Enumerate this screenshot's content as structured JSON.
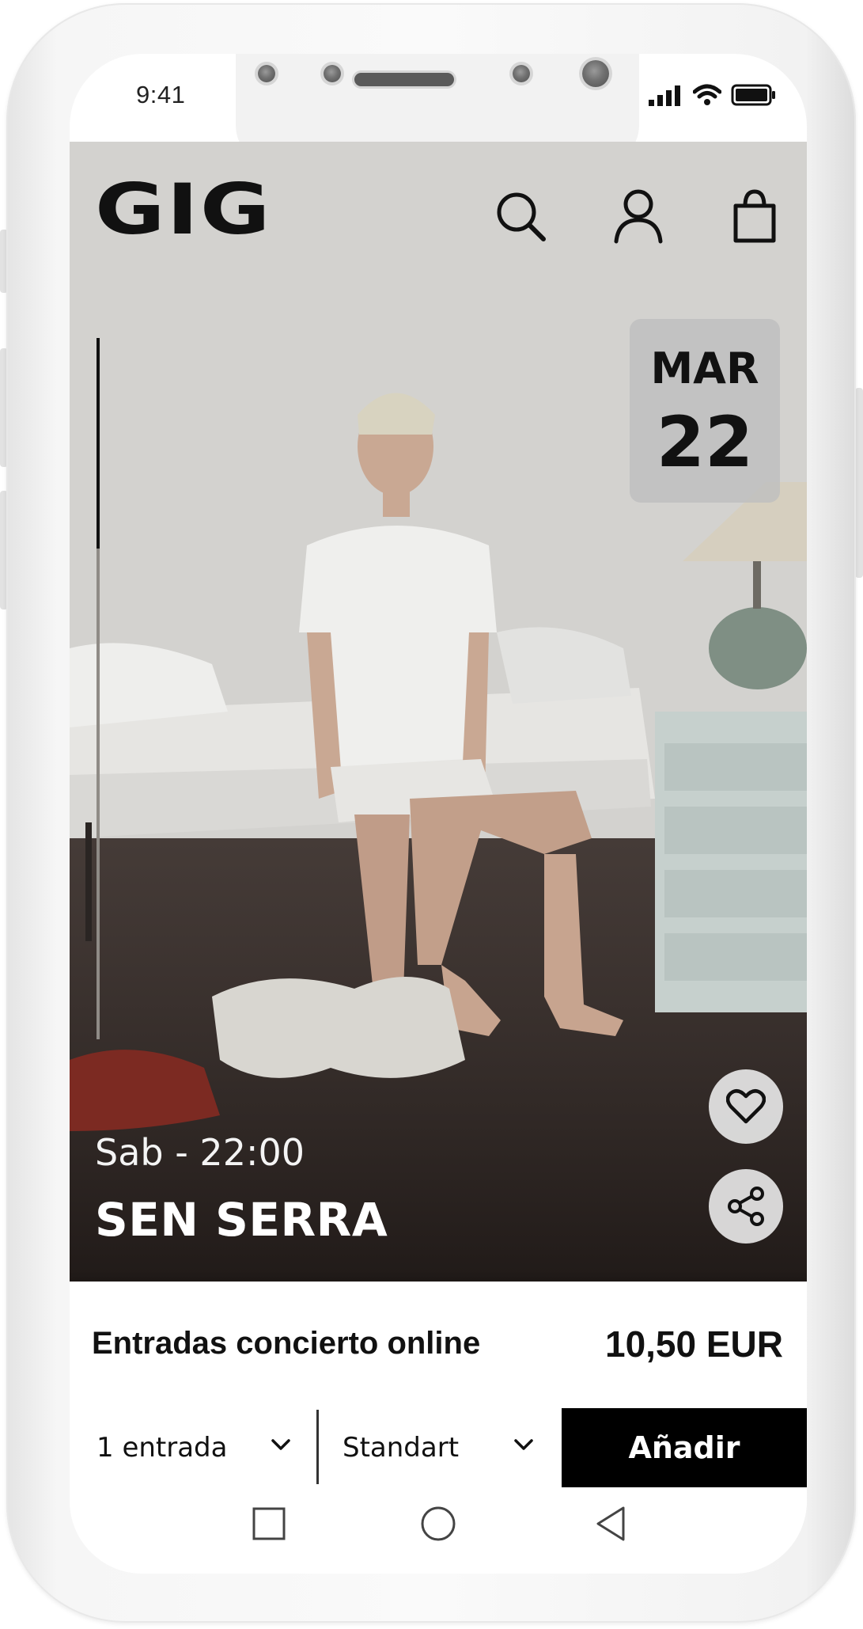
{
  "status_bar": {
    "time": "9:41",
    "icons": [
      "signal-icon",
      "wifi-icon",
      "battery-icon"
    ]
  },
  "header": {
    "logo": "GIG",
    "icons": [
      "search-icon",
      "user-icon",
      "shopping-bag-icon"
    ]
  },
  "event": {
    "date_month": "MAR",
    "date_day": "22",
    "time": "Sab - 22:00",
    "title": "SEN SERRA",
    "gallery_progress": 0.3
  },
  "actions": {
    "favorite_icon": "heart-icon",
    "share_icon": "share-icon"
  },
  "ticket": {
    "label": "Entradas concierto online",
    "price": "10,50 EUR",
    "quantity_selected": "1 entrada",
    "type_selected": "Standart",
    "add_label": "Añadir"
  },
  "navbar": {
    "icons": [
      "recent-apps-icon",
      "home-icon",
      "back-icon"
    ]
  },
  "colors": {
    "accent": "#000000",
    "text_light": "#ffffff",
    "badge_bg": "#bebebe"
  }
}
